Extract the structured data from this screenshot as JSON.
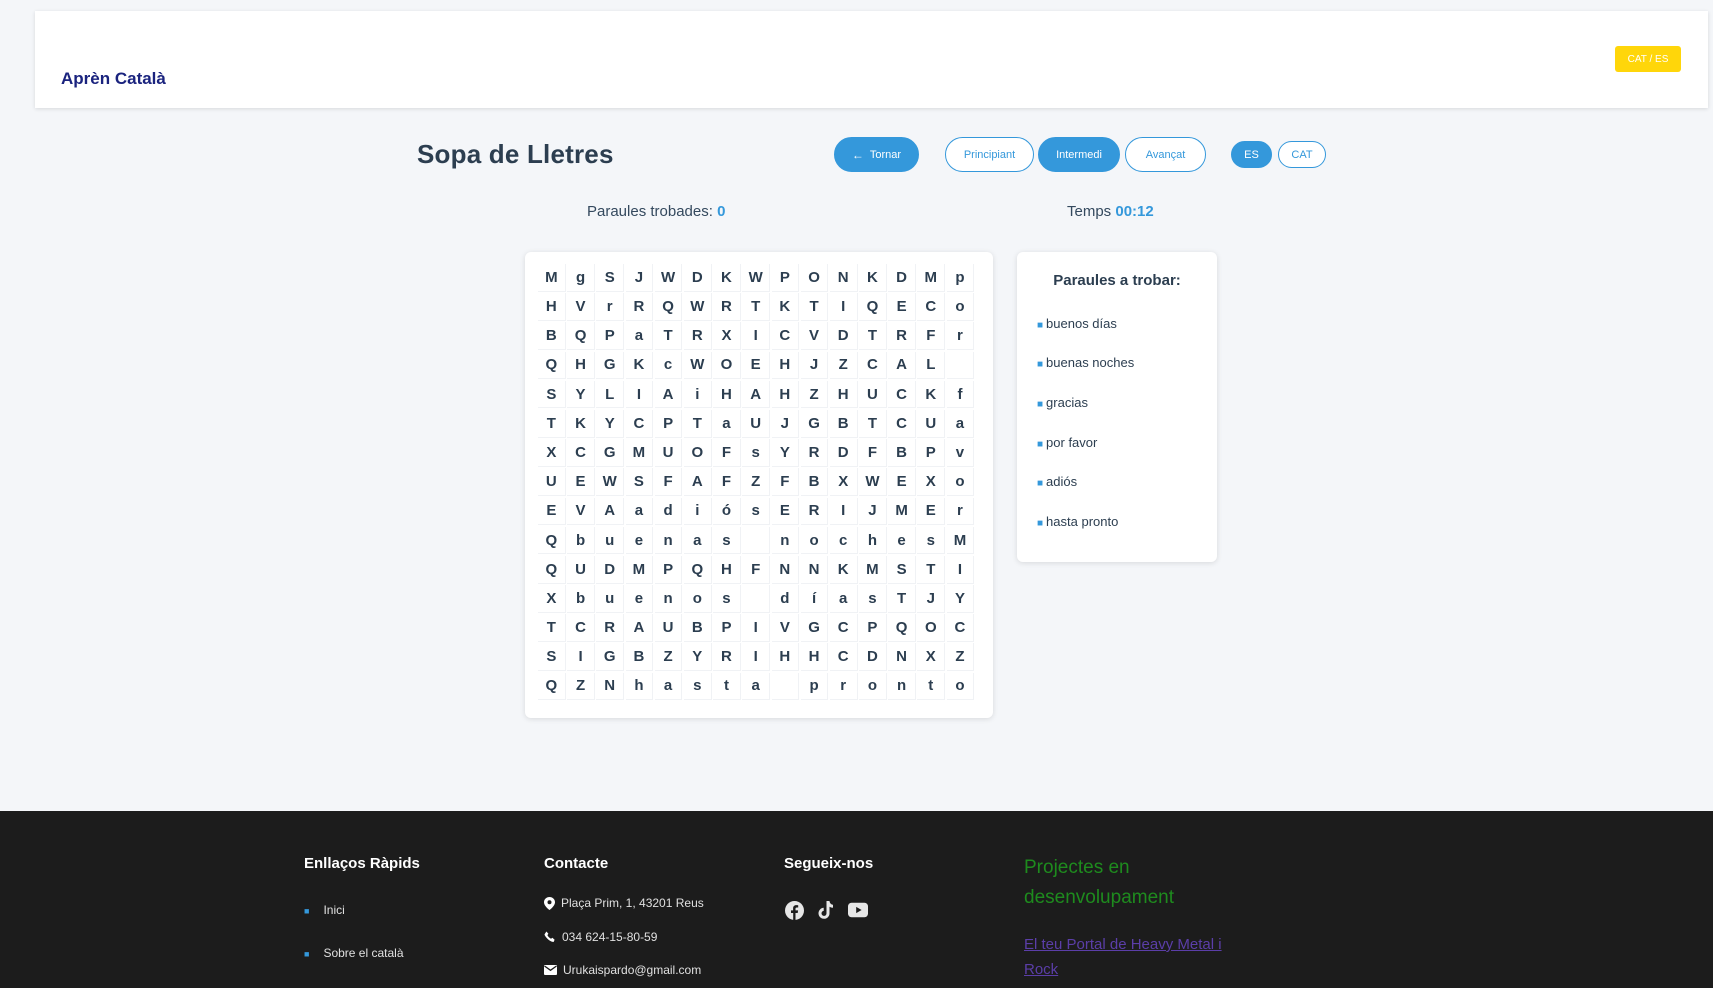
{
  "header": {
    "brand": "Aprèn Català",
    "lang_toggle": "CAT / ES"
  },
  "game": {
    "title": "Sopa de Lletres",
    "back_label": "Tornar",
    "levels": [
      "Principiant",
      "Intermedi",
      "Avançat"
    ],
    "active_level": "Intermedi",
    "languages": [
      "ES",
      "CAT"
    ],
    "active_language": "ES",
    "found_label": "Paraules trobades:",
    "found_value": "0",
    "time_label": "Temps",
    "time_value": "00:12",
    "grid": [
      [
        "M",
        "g",
        "S",
        "J",
        "W",
        "D",
        "K",
        "W",
        "P",
        "O",
        "N",
        "K",
        "D",
        "M",
        "p"
      ],
      [
        "H",
        "V",
        "r",
        "R",
        "Q",
        "W",
        "R",
        "T",
        "K",
        "T",
        "I",
        "Q",
        "E",
        "C",
        "o"
      ],
      [
        "B",
        "Q",
        "P",
        "a",
        "T",
        "R",
        "X",
        "I",
        "C",
        "V",
        "D",
        "T",
        "R",
        "F",
        "r"
      ],
      [
        "Q",
        "H",
        "G",
        "K",
        "c",
        "W",
        "O",
        "E",
        "H",
        "J",
        "Z",
        "C",
        "A",
        "L",
        ""
      ],
      [
        "S",
        "Y",
        "L",
        "I",
        "A",
        "i",
        "H",
        "A",
        "H",
        "Z",
        "H",
        "U",
        "C",
        "K",
        "f"
      ],
      [
        "T",
        "K",
        "Y",
        "C",
        "P",
        "T",
        "a",
        "U",
        "J",
        "G",
        "B",
        "T",
        "C",
        "U",
        "a"
      ],
      [
        "X",
        "C",
        "G",
        "M",
        "U",
        "O",
        "F",
        "s",
        "Y",
        "R",
        "D",
        "F",
        "B",
        "P",
        "v"
      ],
      [
        "U",
        "E",
        "W",
        "S",
        "F",
        "A",
        "F",
        "Z",
        "F",
        "B",
        "X",
        "W",
        "E",
        "X",
        "o"
      ],
      [
        "E",
        "V",
        "A",
        "a",
        "d",
        "i",
        "ó",
        "s",
        "E",
        "R",
        "I",
        "J",
        "M",
        "E",
        "r"
      ],
      [
        "Q",
        "b",
        "u",
        "e",
        "n",
        "a",
        "s",
        "",
        "n",
        "o",
        "c",
        "h",
        "e",
        "s",
        "M"
      ],
      [
        "Q",
        "U",
        "D",
        "M",
        "P",
        "Q",
        "H",
        "F",
        "N",
        "N",
        "K",
        "M",
        "S",
        "T",
        "I"
      ],
      [
        "X",
        "b",
        "u",
        "e",
        "n",
        "o",
        "s",
        "",
        "d",
        "í",
        "a",
        "s",
        "T",
        "J",
        "Y"
      ],
      [
        "T",
        "C",
        "R",
        "A",
        "U",
        "B",
        "P",
        "I",
        "V",
        "G",
        "C",
        "P",
        "Q",
        "O",
        "C"
      ],
      [
        "S",
        "I",
        "G",
        "B",
        "Z",
        "Y",
        "R",
        "I",
        "H",
        "H",
        "C",
        "D",
        "N",
        "X",
        "Z"
      ],
      [
        "Q",
        "Z",
        "N",
        "h",
        "a",
        "s",
        "t",
        "a",
        "",
        "p",
        "r",
        "o",
        "n",
        "t",
        "o"
      ]
    ],
    "words_title": "Paraules a trobar:",
    "words": [
      "buenos días",
      "buenas noches",
      "gracias",
      "por favor",
      "adiós",
      "hasta pronto"
    ]
  },
  "footer": {
    "links_title": "Enllaços Ràpids",
    "links": [
      "Inici",
      "Sobre el català"
    ],
    "contact_title": "Contacte",
    "address": "Plaça Prim, 1, 43201 Reus",
    "phone": "034 624-15-80-59",
    "email": "Urukaispardo@gmail.com",
    "social_title": "Segueix-nos",
    "social_icons": [
      "facebook-icon",
      "tiktok-icon",
      "youtube-icon"
    ],
    "projects_title": "Projectes en desenvolupament",
    "projects_link": "El teu Portal de Heavy Metal i Rock"
  },
  "colors": {
    "accent": "#3498db",
    "brand": "#1a237e",
    "toggle": "#ffd60a",
    "footer_bg": "#1c1c1c",
    "project_green": "#1e8b1e"
  }
}
